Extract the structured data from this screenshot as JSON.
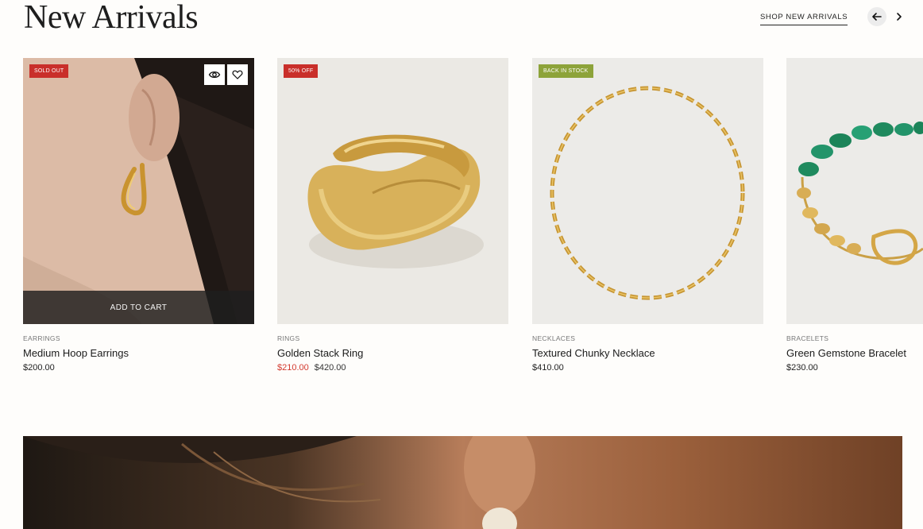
{
  "section": {
    "title": "New Arrivals",
    "shop_link": "SHOP NEW ARRIVALS"
  },
  "nav": {
    "prev_icon": "arrow-left-icon",
    "next_icon": "chevron-right-icon"
  },
  "products": [
    {
      "badge": "SOLD OUT",
      "badge_color": "#c92f2a",
      "category": "EARRINGS",
      "name": "Medium Hoop Earrings",
      "price": "$200.00",
      "add_to_cart": "ADD TO CART"
    },
    {
      "badge": "50% OFF",
      "badge_color": "#c92f2a",
      "category": "RINGS",
      "name": "Golden Stack Ring",
      "sale_price": "$210.00",
      "original_price": "$420.00"
    },
    {
      "badge": "BACK IN STOCK",
      "badge_color": "#8da33a",
      "category": "NECKLACES",
      "name": "Textured Chunky Necklace",
      "price": "$410.00"
    },
    {
      "category": "BRACELETS",
      "name": "Green Gemstone Bracelet",
      "price": "$230.00"
    }
  ],
  "icons": {
    "quick_view": "eye-icon",
    "wishlist": "heart-icon"
  },
  "colors": {
    "sale": "#d33a2f",
    "badge_red": "#c92f2a",
    "badge_green": "#8da33a"
  }
}
